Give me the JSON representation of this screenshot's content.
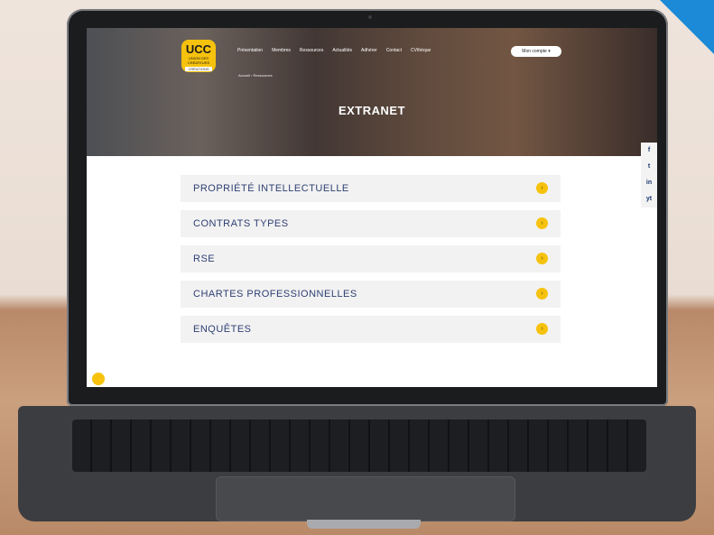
{
  "site": {
    "logo": {
      "main": "UCC",
      "sub": "UNION DES CRÉATEURS",
      "tag": "CRÉATIONS"
    },
    "nav": [
      "Présentation",
      "Membres",
      "Ressources",
      "Actualités",
      "Adhérer",
      "Contact",
      "CVthèque"
    ],
    "account_button": "Mon compte",
    "breadcrumb": "Accueil › Ressources",
    "title": "EXTRANET",
    "social": [
      "f",
      "t",
      "in",
      "yt"
    ]
  },
  "items": [
    {
      "label": "PROPRIÉTÉ INTELLECTUELLE"
    },
    {
      "label": "CONTRATS TYPES"
    },
    {
      "label": "RSE"
    },
    {
      "label": "CHARTES PROFESSIONNELLES"
    },
    {
      "label": "ENQUÊTES"
    }
  ],
  "colors": {
    "accent": "#f6c20d",
    "text": "#2e3f73",
    "corner": "#1c8ad6"
  },
  "icons": {
    "arrow": "chevron-right-icon"
  }
}
